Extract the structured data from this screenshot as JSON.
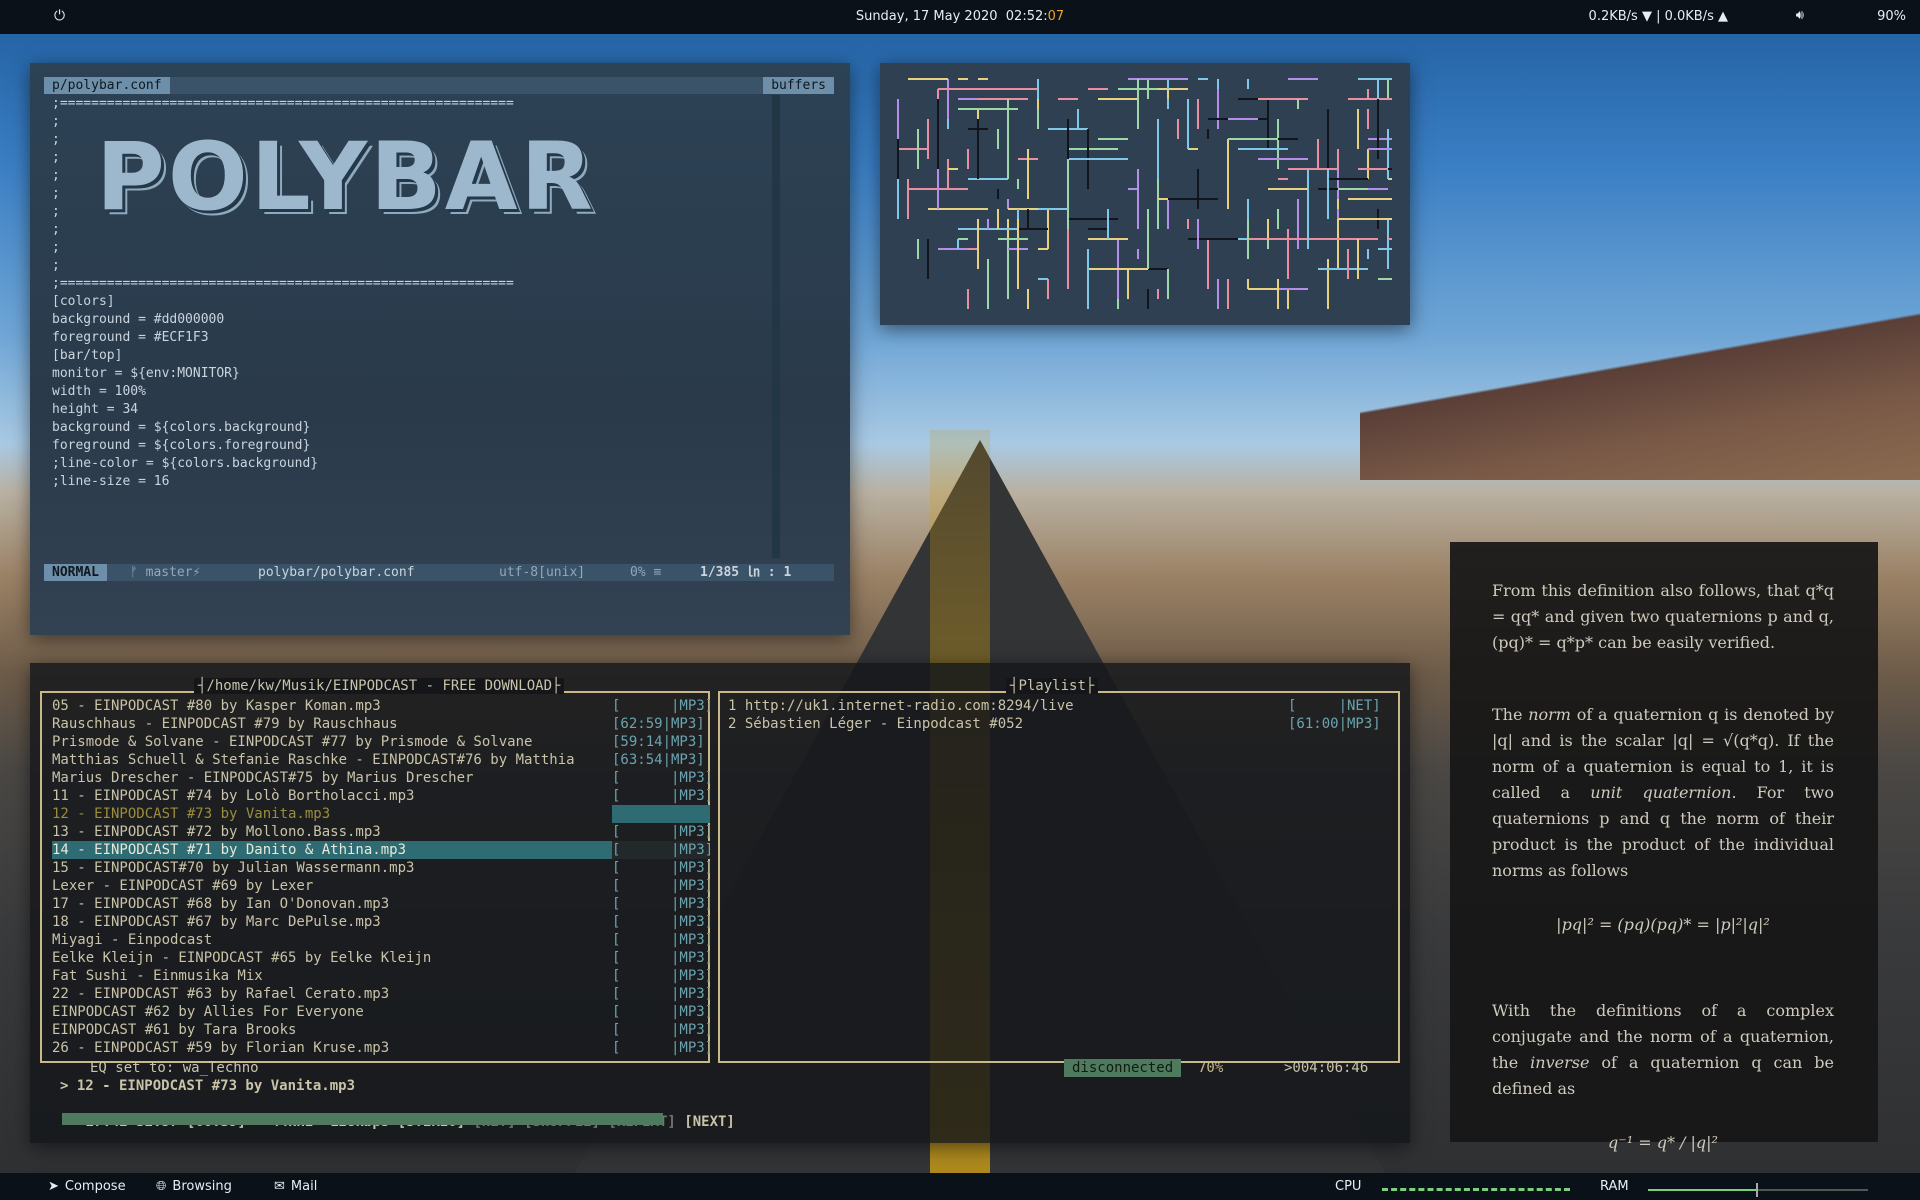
{
  "topbar": {
    "power_icon": "power-icon",
    "date": "Sunday, 17 May 2020",
    "time_hm": "02:52:",
    "time_s": "07",
    "net": "0.2KB/s ▼ | 0.0KB/s ▲",
    "volume_icon": "speaker-icon",
    "battery": "90%"
  },
  "vim": {
    "file_tab": "p/polybar.conf",
    "buffers_tab": "buffers",
    "logo_text": "POLYBAR",
    "lines": [
      ";==========================================================",
      ";",
      ";",
      ";",
      ";",
      ";",
      ";",
      ";",
      ";",
      ";",
      ";==========================================================",
      "",
      "[colors]",
      "background = #dd000000",
      "foreground = #ECF1F3",
      "",
      "[bar/top]",
      "monitor = ${env:MONITOR}",
      "",
      "width = 100%",
      "height = 34",
      "",
      "background = ${colors.background}",
      "foreground = ${colors.foreground}",
      "",
      ";line-color = ${colors.background}",
      ";line-size = 16"
    ],
    "status": {
      "mode": "NORMAL",
      "branch": "ᚠ master⚡",
      "file": "polybar/polybar.conf",
      "encoding": "utf-8[unix]",
      "percent": "0% ≡",
      "position": "1/385 ㏑ :  1"
    }
  },
  "cmus": {
    "library_title": "/home/kw/Musik/EINPODCAST - FREE DOWNLOAD",
    "playlist_title": "Playlist",
    "tracks": [
      {
        "name": "05 - EINPODCAST #80 by Kasper Koman.mp3",
        "dur": "[      |MP3]"
      },
      {
        "name": "Rauschhaus - EINPODCAST #79 by Rauschhaus",
        "dur": "[62:59|MP3]"
      },
      {
        "name": "Prismode & Solvane - EINPODCAST #77 by Prismode & Solvane",
        "dur": "[59:14|MP3]"
      },
      {
        "name": "Matthias Schuell & Stefanie Raschke - EINPODCAST#76 by Matthia",
        "dur": "[63:54|MP3]"
      },
      {
        "name": "Marius Drescher - EINPODCAST#75 by Marius Drescher",
        "dur": "[      |MP3]"
      },
      {
        "name": "11 - EINPODCAST #74 by Lolò Bortholacci.mp3",
        "dur": "[      |MP3]"
      },
      {
        "name": "12 - EINPODCAST #73 by Vanita.mp3",
        "dur": ""
      },
      {
        "name": "13 - EINPODCAST #72 by Mollono.Bass.mp3",
        "dur": "[      |MP3]"
      },
      {
        "name": "14 - EINPODCAST #71 by Danito & Athina.mp3",
        "dur": "[      |MP3]"
      },
      {
        "name": "15 - EINPODCAST#70 by Julian Wassermann.mp3",
        "dur": "[      |MP3]"
      },
      {
        "name": "Lexer - EINPODCAST #69 by Lexer",
        "dur": "[      |MP3]"
      },
      {
        "name": "17 - EINPODCAST #68 by Ian O'Donovan.mp3",
        "dur": "[      |MP3]"
      },
      {
        "name": "18 - EINPODCAST #67 by Marc DePulse.mp3",
        "dur": "[      |MP3]"
      },
      {
        "name": "Miyagi - Einpodcast",
        "dur": "[      |MP3]"
      },
      {
        "name": "Eelke Kleijn - EINPODCAST #65 by Eelke Kleijn",
        "dur": "[      |MP3]"
      },
      {
        "name": "Fat Sushi - Einmusika Mix",
        "dur": "[      |MP3]"
      },
      {
        "name": "22 - EINPODCAST #63 by Rafael Cerato.mp3",
        "dur": "[      |MP3]"
      },
      {
        "name": "EINPODCAST #62 by Allies For Everyone",
        "dur": "[      |MP3]"
      },
      {
        "name": "EINPODCAST #61 by Tara Brooks",
        "dur": "[      |MP3]"
      },
      {
        "name": "26 - EINPODCAST #59 by Florian Kruse.mp3",
        "dur": "[      |MP3]"
      }
    ],
    "playlist": [
      {
        "name": "1 http://uk1.internet-radio.com:8294/live",
        "dur": "[     |NET]"
      },
      {
        "name": "2 Sébastien Léger - Einpodcast #052",
        "dur": "[61:00|MP3]"
      }
    ],
    "eq": "EQ set to: wa_Techno",
    "status_badge": "disconnected",
    "volume": "70%",
    "remaining": ">004:06:46",
    "now_playing": "> 12 - EINPODCAST #73 by Vanita.mp3",
    "info_time": "27:42 32:57 [60:39]",
    "info_rate": "44kHz",
    "info_bitrate": "128kbps",
    "info_stereo": "[STEREO]",
    "flag_net": "[NET]",
    "flag_shuffle": "[SHUFFLE]",
    "flag_repeat": "[REPEAT]",
    "flag_next": "[NEXT]",
    "progress": 0.45
  },
  "math": {
    "p1": "From this definition also follows, that q*q = qq* and given two quaternions p and q, (pq)* = q*p* can be easily verified.",
    "p2a": "The ",
    "p2b": "norm",
    "p2c": " of a quaternion q is denoted by |q| and is the scalar |q| = √(q*q). If the norm of a quaternion is equal to 1, it is called a ",
    "p2d": "unit quaternion",
    "p2e": ". For two quaternions p and q the norm of their product is the product of the individual norms as follows",
    "eq1": "|pq|² = (pq)(pq)* = |p|²|q|²",
    "p3a": "With the definitions of a complex conjugate and the norm of a quaternion, the ",
    "p3b": "inverse",
    "p3c": " of a quaternion q can be defined as",
    "eq2": "q⁻¹ = q* / |q|²"
  },
  "botbar": {
    "workspaces": [
      {
        "icon": "send-icon",
        "label": "Compose"
      },
      {
        "icon": "globe-icon",
        "label": "Browsing"
      },
      {
        "icon": "mail-icon",
        "label": "Mail"
      }
    ],
    "cpu_label": "CPU",
    "ram_label": "RAM"
  }
}
